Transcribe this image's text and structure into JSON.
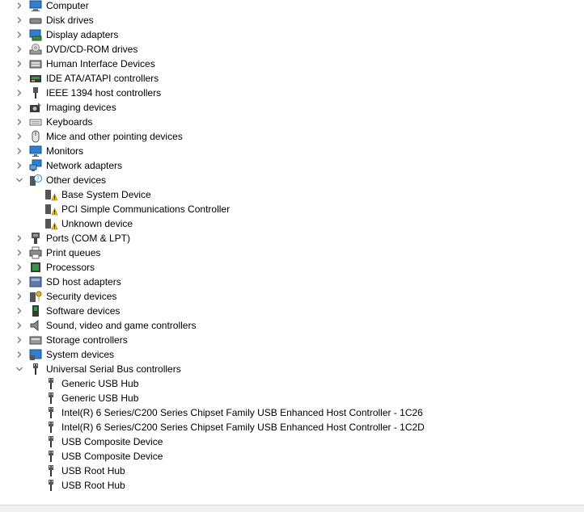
{
  "tree": [
    {
      "label": "Computer",
      "icon": "computer-icon",
      "level": 0,
      "expander": "collapsed"
    },
    {
      "label": "Disk drives",
      "icon": "disk-drive-icon",
      "level": 0,
      "expander": "collapsed"
    },
    {
      "label": "Display adapters",
      "icon": "display-adapter-icon",
      "level": 0,
      "expander": "collapsed"
    },
    {
      "label": "DVD/CD-ROM drives",
      "icon": "dvd-drive-icon",
      "level": 0,
      "expander": "collapsed"
    },
    {
      "label": "Human Interface Devices",
      "icon": "hid-icon",
      "level": 0,
      "expander": "collapsed"
    },
    {
      "label": "IDE ATA/ATAPI controllers",
      "icon": "ide-controller-icon",
      "level": 0,
      "expander": "collapsed"
    },
    {
      "label": "IEEE 1394 host controllers",
      "icon": "ieee1394-icon",
      "level": 0,
      "expander": "collapsed"
    },
    {
      "label": "Imaging devices",
      "icon": "camera-icon",
      "level": 0,
      "expander": "collapsed"
    },
    {
      "label": "Keyboards",
      "icon": "keyboard-icon",
      "level": 0,
      "expander": "collapsed"
    },
    {
      "label": "Mice and other pointing devices",
      "icon": "mouse-icon",
      "level": 0,
      "expander": "collapsed"
    },
    {
      "label": "Monitors",
      "icon": "monitor-icon",
      "level": 0,
      "expander": "collapsed"
    },
    {
      "label": "Network adapters",
      "icon": "network-adapter-icon",
      "level": 0,
      "expander": "collapsed"
    },
    {
      "label": "Other devices",
      "icon": "unknown-device-icon",
      "level": 0,
      "expander": "expanded"
    },
    {
      "label": "Base System Device",
      "icon": "warning-device-icon",
      "level": 1,
      "expander": "none"
    },
    {
      "label": "PCI Simple Communications Controller",
      "icon": "warning-device-icon",
      "level": 1,
      "expander": "none"
    },
    {
      "label": "Unknown device",
      "icon": "warning-device-icon",
      "level": 1,
      "expander": "none"
    },
    {
      "label": "Ports (COM & LPT)",
      "icon": "port-icon",
      "level": 0,
      "expander": "collapsed"
    },
    {
      "label": "Print queues",
      "icon": "printer-icon",
      "level": 0,
      "expander": "collapsed"
    },
    {
      "label": "Processors",
      "icon": "processor-icon",
      "level": 0,
      "expander": "collapsed"
    },
    {
      "label": "SD host adapters",
      "icon": "sd-adapter-icon",
      "level": 0,
      "expander": "collapsed"
    },
    {
      "label": "Security devices",
      "icon": "security-key-icon",
      "level": 0,
      "expander": "collapsed"
    },
    {
      "label": "Software devices",
      "icon": "software-device-icon",
      "level": 0,
      "expander": "collapsed"
    },
    {
      "label": "Sound, video and game controllers",
      "icon": "speaker-icon",
      "level": 0,
      "expander": "collapsed"
    },
    {
      "label": "Storage controllers",
      "icon": "storage-controller-icon",
      "level": 0,
      "expander": "collapsed"
    },
    {
      "label": "System devices",
      "icon": "system-device-icon",
      "level": 0,
      "expander": "collapsed"
    },
    {
      "label": "Universal Serial Bus controllers",
      "icon": "usb-icon",
      "level": 0,
      "expander": "expanded"
    },
    {
      "label": "Generic USB Hub",
      "icon": "usb-icon",
      "level": 1,
      "expander": "none"
    },
    {
      "label": "Generic USB Hub",
      "icon": "usb-icon",
      "level": 1,
      "expander": "none"
    },
    {
      "label": "Intel(R) 6 Series/C200 Series Chipset Family USB Enhanced Host Controller - 1C26",
      "icon": "usb-icon",
      "level": 1,
      "expander": "none"
    },
    {
      "label": "Intel(R) 6 Series/C200 Series Chipset Family USB Enhanced Host Controller - 1C2D",
      "icon": "usb-icon",
      "level": 1,
      "expander": "none"
    },
    {
      "label": "USB Composite Device",
      "icon": "usb-icon",
      "level": 1,
      "expander": "none"
    },
    {
      "label": "USB Composite Device",
      "icon": "usb-icon",
      "level": 1,
      "expander": "none"
    },
    {
      "label": "USB Root Hub",
      "icon": "usb-icon",
      "level": 1,
      "expander": "none"
    },
    {
      "label": "USB Root Hub",
      "icon": "usb-icon",
      "level": 1,
      "expander": "none"
    }
  ],
  "colors": {
    "text": "#000000",
    "chevron": "#606060",
    "icon_blue": "#2f7fd0",
    "icon_gray": "#5a5a5a",
    "warning": "#f2c11c"
  }
}
